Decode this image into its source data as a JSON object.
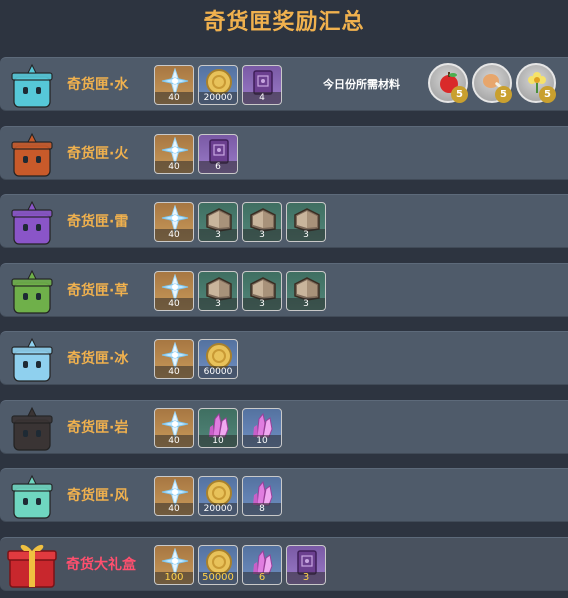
{
  "page": {
    "title": "奇货匣奖励汇总"
  },
  "required_materials": {
    "label": "今日份所需材料",
    "items": [
      {
        "icon": "apple-icon",
        "count": "5"
      },
      {
        "icon": "drumstick-icon",
        "count": "5"
      },
      {
        "icon": "flower-icon",
        "count": "5"
      }
    ]
  },
  "rows": [
    {
      "name": "奇货匣·水",
      "box_icon": "water-box-icon",
      "box_color": "#56c8d8",
      "rewards": [
        {
          "icon": "crystal-icon",
          "tier": "gold",
          "count": "40"
        },
        {
          "icon": "mora-coin-icon",
          "tier": "blue",
          "count": "20000"
        },
        {
          "icon": "book-icon",
          "tier": "purple",
          "count": "4"
        }
      ]
    },
    {
      "name": "奇货匣·火",
      "box_icon": "fire-box-icon",
      "box_color": "#c85a2a",
      "rewards": [
        {
          "icon": "crystal-icon",
          "tier": "gold",
          "count": "40"
        },
        {
          "icon": "book-icon",
          "tier": "purple",
          "count": "6"
        }
      ]
    },
    {
      "name": "奇货匣·雷",
      "box_icon": "electro-box-icon",
      "box_color": "#8a55c8",
      "rewards": [
        {
          "icon": "crystal-icon",
          "tier": "gold",
          "count": "40"
        },
        {
          "icon": "talent-book-icon",
          "tier": "green",
          "count": "3"
        },
        {
          "icon": "talent-book-icon",
          "tier": "green",
          "count": "3"
        },
        {
          "icon": "talent-book-icon",
          "tier": "green",
          "count": "3"
        }
      ]
    },
    {
      "name": "奇货匣·草",
      "box_icon": "dendro-box-icon",
      "box_color": "#6fb04a",
      "rewards": [
        {
          "icon": "crystal-icon",
          "tier": "gold",
          "count": "40"
        },
        {
          "icon": "talent-book-icon",
          "tier": "green",
          "count": "3"
        },
        {
          "icon": "talent-book-icon",
          "tier": "green",
          "count": "3"
        },
        {
          "icon": "talent-book-icon",
          "tier": "green",
          "count": "3"
        }
      ]
    },
    {
      "name": "奇货匣·冰",
      "box_icon": "cryo-box-icon",
      "box_color": "#8fd0ee",
      "rewards": [
        {
          "icon": "crystal-icon",
          "tier": "gold",
          "count": "40"
        },
        {
          "icon": "mora-coin-icon",
          "tier": "blue",
          "count": "60000"
        }
      ]
    },
    {
      "name": "奇货匣·岩",
      "box_icon": "geo-box-icon",
      "box_color": "#3a3434",
      "rewards": [
        {
          "icon": "crystal-icon",
          "tier": "gold",
          "count": "40"
        },
        {
          "icon": "ore-crystal-icon",
          "tier": "green",
          "count": "10"
        },
        {
          "icon": "ore-crystal-icon",
          "tier": "blue",
          "count": "10"
        }
      ]
    },
    {
      "name": "奇货匣·风",
      "box_icon": "anemo-box-icon",
      "box_color": "#6fd6c0",
      "rewards": [
        {
          "icon": "crystal-icon",
          "tier": "gold",
          "count": "40"
        },
        {
          "icon": "mora-coin-icon",
          "tier": "blue",
          "count": "20000"
        },
        {
          "icon": "ore-crystal-icon",
          "tier": "blue",
          "count": "8"
        }
      ]
    },
    {
      "name": "奇货大礼盒",
      "box_icon": "gift-box-icon",
      "box_color": "#c8272d",
      "gift": true,
      "rewards": [
        {
          "icon": "crystal-icon",
          "tier": "gold",
          "count": "100"
        },
        {
          "icon": "mora-coin-icon",
          "tier": "blue",
          "count": "50000"
        },
        {
          "icon": "ore-crystal-icon",
          "tier": "blue",
          "count": "6"
        },
        {
          "icon": "book-icon",
          "tier": "purple",
          "count": "3"
        }
      ]
    }
  ]
}
